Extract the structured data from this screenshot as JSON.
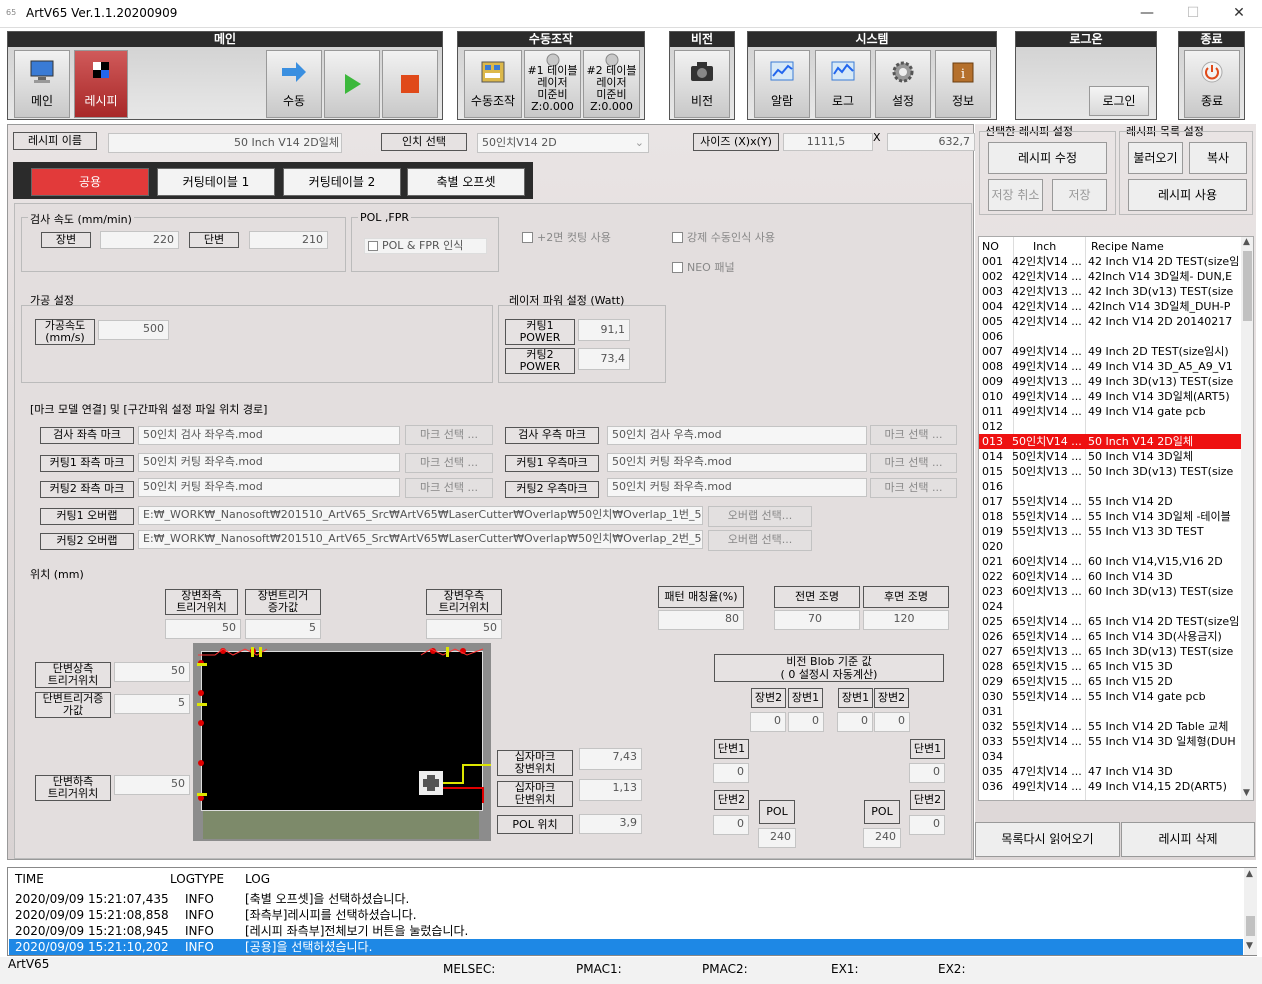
{
  "window": {
    "title": "ArtV65 Ver.1.1.20200909",
    "icon": "app-icon",
    "min": "—",
    "max": "☐",
    "close": "✕"
  },
  "toolbar": {
    "main": {
      "header": "메인",
      "buttons": [
        "메인",
        "레시피",
        "수동"
      ]
    },
    "manual": {
      "header": "수동조작",
      "buttons": [
        "수동조작",
        "#1 테이블 레이저 미준비 Z:0.000",
        "#2 테이블 레이저 미준비 Z:0.000"
      ],
      "t1": [
        "#1 테이블",
        "레이저",
        "미준비",
        "Z:0.000"
      ],
      "t2": [
        "#2 테이블",
        "레이저",
        "미준비",
        "Z:0.000"
      ]
    },
    "vision": {
      "header": "비전",
      "buttons": [
        "비전"
      ]
    },
    "system": {
      "header": "시스템",
      "buttons": [
        "알람",
        "로그",
        "설정",
        "정보"
      ]
    },
    "login": {
      "header": "로그온",
      "button": "로그인"
    },
    "exit": {
      "header": "종료",
      "button": "종료"
    }
  },
  "recipe": {
    "name_label": "레시피 이름",
    "name_value": "50 Inch V14 2D일체",
    "inch_label": "인치 선택",
    "inch_value": "50인치V14 2D",
    "size_label": "사이즈 (X)x(Y)",
    "size_x": "1111,5",
    "size_sep": "X",
    "size_y": "632,7"
  },
  "tabs": [
    "공용",
    "커팅테이블 1",
    "커팅테이블 2",
    "축별 오프셋"
  ],
  "speed": {
    "title": "검사 속도 (mm/min)",
    "long_label": "장변",
    "long_value": "220",
    "short_label": "단변",
    "short_value": "210"
  },
  "pol": {
    "title": "POL ,FPR",
    "check": "POL & FPR 인식"
  },
  "options": {
    "double_cut": "+2면 컷팅 사용",
    "force_manual": "강제 수동인식 사용",
    "neo": "NEO 패널"
  },
  "machining": {
    "title": "가공 설정",
    "speed_label": "가공속도 (mm/s)",
    "speed_l1": "가공속도",
    "speed_l2": "(mm/s)",
    "speed_value": "500"
  },
  "laser": {
    "title": "레이저 파워 설정 (Watt)",
    "c1_l1": "커팅1",
    "c1_l2": "POWER",
    "c1_value": "91,1",
    "c2_l1": "커팅2",
    "c2_l2": "POWER",
    "c2_value": "73,4"
  },
  "marks": {
    "title": "[마크 모델 연결] 및 [구간파워 설정 파일 위치 경로]",
    "select": "마크 선택 ...",
    "overlap_select": "오버랩 선택...",
    "insp_left": "검사 좌측 마크",
    "insp_left_val": "50인치 검사 좌우측.mod",
    "insp_right": "검사 우측 마크",
    "insp_right_val": "50인치 검사 우측.mod",
    "cut1_left": "커팅1 좌측 마크",
    "cut1_left_val": "50인치 커팅 좌우측.mod",
    "cut1_right": "커팅1 우측마크",
    "cut1_right_val": "50인치 커팅 좌우측.mod",
    "cut2_left": "커팅2 좌측 마크",
    "cut2_left_val": "50인치 커팅 좌우측.mod",
    "cut2_right": "커팅2 우측마크",
    "cut2_right_val": "50인치 커팅 좌우측.mod",
    "ov1": "커팅1 오버랩",
    "ov1_val": "E:₩_WORK₩_Nanosoft₩201510_ArtV65_Src₩ArtV65₩LaserCutter₩Overlap₩50인치₩Overlap_1번_5",
    "ov2": "커팅2 오버랩",
    "ov2_val": "E:₩_WORK₩_Nanosoft₩201510_ArtV65_Src₩ArtV65₩LaserCutter₩Overlap₩50인치₩Overlap_2번_5"
  },
  "position": {
    "title": "위치 (mm)",
    "lt_l1": "장변좌측",
    "lt_l2": "트리거위치",
    "lt_val": "50",
    "li_l1": "장변트리거",
    "li_l2": "증가값",
    "li_val": "5",
    "rt_l1": "장변우측",
    "rt_l2": "트리거위치",
    "rt_val": "50",
    "st_l1": "단변상측",
    "st_l2": "트리거위치",
    "st_val": "50",
    "si_l1": "단변트리거증",
    "si_l2": "가값",
    "si_val": "5",
    "sb_l1": "단변하측",
    "sb_l2": "트리거위치",
    "sb_val": "50",
    "cl_l1": "십자마크",
    "cl_l2": "장변위치",
    "cl_val": "7,43",
    "cs_l1": "십자마크",
    "cs_l2": "단변위치",
    "cs_val": "1,13",
    "pol_label": "POL 위치",
    "pol_val": "3,9"
  },
  "pattern": {
    "label": "패턴 매칭율(%)",
    "value": "80",
    "front_label": "전면 조명",
    "front_value": "70",
    "back_label": "후면 조명",
    "back_value": "120"
  },
  "blob": {
    "title_l1": "비전 Blob 기준 값",
    "title_l2": "( 0 설정시 자동계산)",
    "long2": "장변2",
    "long1": "장변1",
    "short1": "단변1",
    "short2": "단변2",
    "pol": "POL",
    "v0": "0",
    "v240": "240"
  },
  "right": {
    "sel_title": "선택한 레시피 설정",
    "list_title": "레시피 목록 설정",
    "edit": "레시피 수정",
    "load": "불러오기",
    "copy": "복사",
    "cancel": "저장 취소",
    "save": "저장",
    "use": "레시피 사용",
    "reload": "목록다시 읽어오기",
    "delete": "레시피 삭제"
  },
  "list": {
    "headers": [
      "NO",
      "Inch",
      "Recipe Name"
    ],
    "rows": [
      [
        "001",
        "42인치V14 ...",
        "42 Inch V14 2D TEST(size임"
      ],
      [
        "002",
        "42인치V14 ...",
        "42Inch V14 3D일체- DUN,E"
      ],
      [
        "003",
        "42인치V13 ...",
        "42 Inch 3D(v13) TEST(size"
      ],
      [
        "004",
        "42인치V14 ...",
        "42Inch V14 3D일체_DUH-P"
      ],
      [
        "005",
        "42인치V14 ...",
        "42 Inch V14 2D 20140217"
      ],
      [
        "006",
        "",
        ""
      ],
      [
        "007",
        "49인치V14 ...",
        "49 Inch 2D TEST(size임시)"
      ],
      [
        "008",
        "49인치V14 ...",
        "49 Inch V14 3D_A5_A9_V1"
      ],
      [
        "009",
        "49인치V13 ...",
        "49 Inch 3D(v13) TEST(size"
      ],
      [
        "010",
        "49인치V14 ...",
        "49 Inch V14 3D일체(ART5)"
      ],
      [
        "011",
        "49인치V14 ...",
        "49 Inch V14 gate pcb"
      ],
      [
        "012",
        "",
        ""
      ],
      [
        "013",
        "50인치V14 ...",
        "50 Inch V14 2D일체"
      ],
      [
        "014",
        "50인치V14 ...",
        "50 Inch V14 3D일체"
      ],
      [
        "015",
        "50인치V13 ...",
        "50 Inch 3D(v13) TEST(size"
      ],
      [
        "016",
        "",
        ""
      ],
      [
        "017",
        "55인치V14 ...",
        "55 Inch V14 2D"
      ],
      [
        "018",
        "55인치V14 ...",
        "55 Inch V14 3D일체 -테이블"
      ],
      [
        "019",
        "55인치V13 ...",
        "55 Inch V13 3D TEST"
      ],
      [
        "020",
        "",
        ""
      ],
      [
        "021",
        "60인치V14 ...",
        "60 Inch V14,V15,V16 2D"
      ],
      [
        "022",
        "60인치V14 ...",
        "60 Inch V14 3D"
      ],
      [
        "023",
        "60인치V13 ...",
        "60 Inch 3D(v13) TEST(size"
      ],
      [
        "024",
        "",
        ""
      ],
      [
        "025",
        "65인치V14 ...",
        "65 Inch V14 2D TEST(size임"
      ],
      [
        "026",
        "65인치V14 ...",
        "65 Inch V14 3D(사용금지)"
      ],
      [
        "027",
        "65인치V13 ...",
        "65 Inch 3D(v13) TEST(size"
      ],
      [
        "028",
        "65인치V15 ...",
        "65 Inch V15 3D"
      ],
      [
        "029",
        "65인치V15 ...",
        "65 Inch V15 2D"
      ],
      [
        "030",
        "55인치V14 ...",
        "55 Inch V14 gate pcb"
      ],
      [
        "031",
        "",
        ""
      ],
      [
        "032",
        "55인치V14 ...",
        "55 Inch V14 2D Table 교체"
      ],
      [
        "033",
        "55인치V14 ...",
        "55 Inch V14 3D 일체형(DUH"
      ],
      [
        "034",
        "",
        ""
      ],
      [
        "035",
        "47인치V14 ...",
        "47 Inch V14 3D"
      ],
      [
        "036",
        "49인치V14 ...",
        "49 Inch V14,15 2D(ART5)"
      ]
    ],
    "selected_index": 12
  },
  "log": {
    "headers": [
      "TIME",
      "LOGTYPE",
      "LOG"
    ],
    "rows": [
      [
        "2020/09/09 15:21:07,435",
        "INFO",
        "[축별 오프셋]을 선택하셨습니다."
      ],
      [
        "2020/09/09 15:21:08,858",
        "INFO",
        "[좌측부]레시피를 선택하셨습니다."
      ],
      [
        "2020/09/09 15:21:08,945",
        "INFO",
        "[레시피 좌측부]전체보기 버튼을 눌렀습니다."
      ],
      [
        "2020/09/09 15:21:10,202",
        "INFO",
        "[공용]을 선택하셨습니다."
      ]
    ]
  },
  "status": {
    "app": "ArtV65",
    "melsec": "MELSEC:",
    "pmac1": "PMAC1:",
    "pmac2": "PMAC2:",
    "ex1": "EX1:",
    "ex2": "EX2:"
  },
  "colors": {
    "selected": "#ee1111",
    "accent": "#e23a3a",
    "log_select": "#1e88e5",
    "header": "#2b2b2b"
  }
}
